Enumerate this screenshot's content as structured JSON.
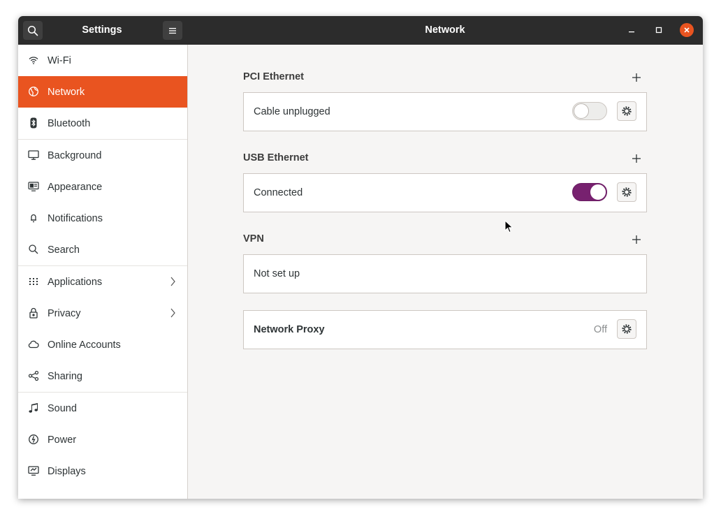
{
  "titlebar": {
    "app_title": "Settings",
    "page_title": "Network",
    "icons": {
      "search": "search-icon",
      "menu": "hamburger-menu-icon",
      "minimize": "minimize-icon",
      "maximize": "maximize-icon",
      "close": "close-icon"
    }
  },
  "sidebar": {
    "items": [
      {
        "label": "Wi-Fi",
        "icon": "wifi-icon"
      },
      {
        "label": "Network",
        "icon": "globe-icon",
        "active": true
      },
      {
        "label": "Bluetooth",
        "icon": "bluetooth-icon"
      },
      {
        "label": "Background",
        "icon": "monitor-icon"
      },
      {
        "label": "Appearance",
        "icon": "appearance-icon"
      },
      {
        "label": "Notifications",
        "icon": "bell-icon"
      },
      {
        "label": "Search",
        "icon": "search-icon"
      },
      {
        "label": "Applications",
        "icon": "grid-icon",
        "has_submenu": true
      },
      {
        "label": "Privacy",
        "icon": "lock-icon",
        "has_submenu": true
      },
      {
        "label": "Online Accounts",
        "icon": "cloud-icon"
      },
      {
        "label": "Sharing",
        "icon": "share-icon"
      },
      {
        "label": "Sound",
        "icon": "music-note-icon"
      },
      {
        "label": "Power",
        "icon": "power-icon"
      },
      {
        "label": "Displays",
        "icon": "display-icon"
      }
    ]
  },
  "main": {
    "pci": {
      "title": "PCI Ethernet",
      "status": "Cable unplugged",
      "enabled": false
    },
    "usb": {
      "title": "USB Ethernet",
      "status": "Connected",
      "enabled": true
    },
    "vpn": {
      "title": "VPN",
      "status": "Not set up"
    },
    "proxy": {
      "label": "Network Proxy",
      "status": "Off"
    }
  },
  "colors": {
    "accent": "#e95420",
    "toggle_on": "#77216f",
    "titlebar": "#2c2c2c"
  }
}
